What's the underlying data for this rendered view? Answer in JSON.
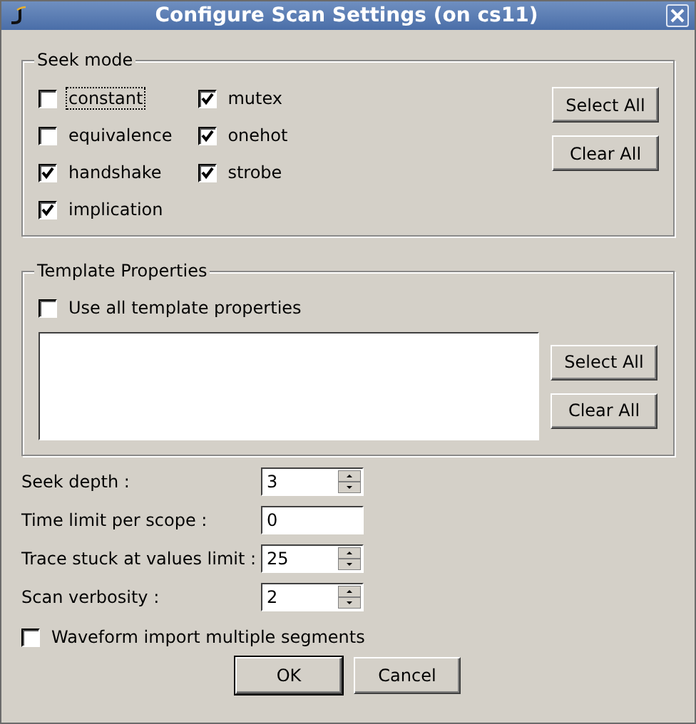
{
  "window": {
    "title": "Configure Scan Settings (on cs11)"
  },
  "seek_mode": {
    "title": "Seek mode",
    "columns": [
      [
        {
          "label": "constant",
          "checked": false,
          "focused": true
        },
        {
          "label": "equivalence",
          "checked": false,
          "focused": false
        },
        {
          "label": "handshake",
          "checked": true,
          "focused": false
        },
        {
          "label": "implication",
          "checked": true,
          "focused": false
        }
      ],
      [
        {
          "label": "mutex",
          "checked": true,
          "focused": false
        },
        {
          "label": "onehot",
          "checked": true,
          "focused": false
        },
        {
          "label": "strobe",
          "checked": true,
          "focused": false
        }
      ]
    ],
    "buttons": [
      "Select All",
      "Clear All"
    ]
  },
  "template_properties": {
    "title": "Template Properties",
    "use_all": {
      "label": "Use all template properties",
      "checked": false
    },
    "buttons": [
      "Select All",
      "Clear All"
    ]
  },
  "fields": [
    {
      "kind": "spinner",
      "label": "Seek depth :",
      "value": "3"
    },
    {
      "kind": "text",
      "label": "Time limit per scope :",
      "value": "0"
    },
    {
      "kind": "spinner",
      "label": "Trace stuck at values limit :",
      "value": "25"
    },
    {
      "kind": "spinner",
      "label": "Scan verbosity :",
      "value": "2"
    }
  ],
  "waveform": {
    "label": "Waveform import multiple segments",
    "checked": false
  },
  "buttons": [
    {
      "label": "OK",
      "default": true
    },
    {
      "label": "Cancel",
      "default": false
    }
  ]
}
